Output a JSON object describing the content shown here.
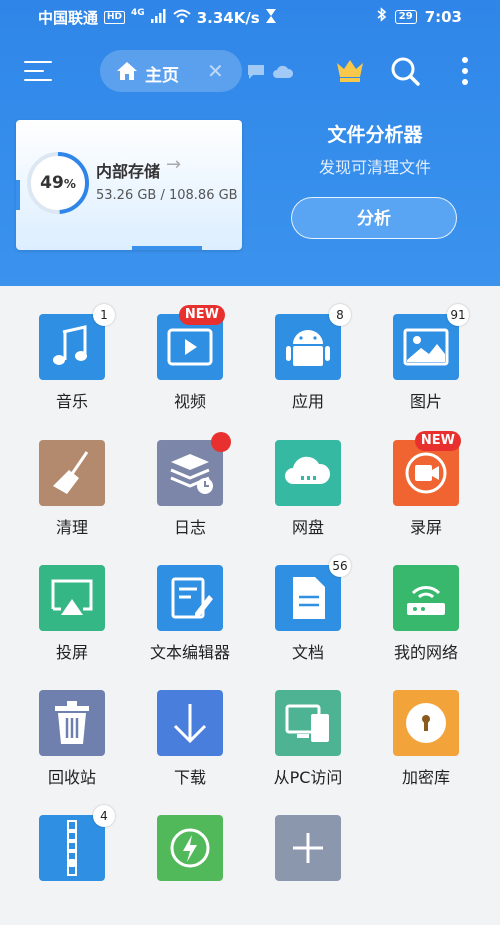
{
  "status_bar": {
    "carrier": "中国联通",
    "hd": "HD",
    "network": "4G",
    "speed": "3.34K/s",
    "battery": "29",
    "time": "7:03"
  },
  "toolbar": {
    "tab_label": "主页",
    "icons": [
      "menu-icon",
      "home-icon",
      "close-icon",
      "chat-icon",
      "cloud-icon",
      "crown-icon",
      "search-icon",
      "more-icon"
    ]
  },
  "storage": {
    "percent_text": "49",
    "percent_sign": "%",
    "percent_value": 49,
    "title": "内部存储",
    "arrow": "→",
    "size": "53.26 GB / 108.86 GB"
  },
  "analyzer": {
    "title": "文件分析器",
    "subtitle": "发现可清理文件",
    "button": "分析"
  },
  "grid": [
    {
      "label": "音乐",
      "badge": "1",
      "badge_type": "num",
      "color": "#2f8fe3"
    },
    {
      "label": "视频",
      "badge": "NEW",
      "badge_type": "new",
      "color": "#2f8fe3"
    },
    {
      "label": "应用",
      "badge": "8",
      "badge_type": "num",
      "color": "#2f8fe3"
    },
    {
      "label": "图片",
      "badge": "91",
      "badge_type": "num",
      "color": "#2f8fe3"
    },
    {
      "label": "清理",
      "badge": "",
      "badge_type": "none",
      "color": "#b38a6d"
    },
    {
      "label": "日志",
      "badge": "",
      "badge_type": "dot",
      "color": "#7c86a8"
    },
    {
      "label": "网盘",
      "badge": "",
      "badge_type": "none",
      "color": "#35b9a3"
    },
    {
      "label": "录屏",
      "badge": "NEW",
      "badge_type": "new",
      "color": "#ef6431"
    },
    {
      "label": "投屏",
      "badge": "",
      "badge_type": "none",
      "color": "#34b685"
    },
    {
      "label": "文本编辑器",
      "badge": "",
      "badge_type": "none",
      "color": "#2f8fe3"
    },
    {
      "label": "文档",
      "badge": "56",
      "badge_type": "num",
      "color": "#2f8fe3"
    },
    {
      "label": "我的网络",
      "badge": "",
      "badge_type": "none",
      "color": "#38b86d"
    },
    {
      "label": "回收站",
      "badge": "",
      "badge_type": "none",
      "color": "#6f7fae"
    },
    {
      "label": "下载",
      "badge": "",
      "badge_type": "none",
      "color": "#4a7edd"
    },
    {
      "label": "从PC访问",
      "badge": "",
      "badge_type": "none",
      "color": "#4db392"
    },
    {
      "label": "加密库",
      "badge": "",
      "badge_type": "none",
      "color": "#f2a33a"
    },
    {
      "label": "",
      "badge": "4",
      "badge_type": "num",
      "color": "#2f8fe3"
    },
    {
      "label": "",
      "badge": "",
      "badge_type": "none",
      "color": "#52b95a"
    },
    {
      "label": "",
      "badge": "",
      "badge_type": "none",
      "color": "#8a97ad"
    }
  ]
}
